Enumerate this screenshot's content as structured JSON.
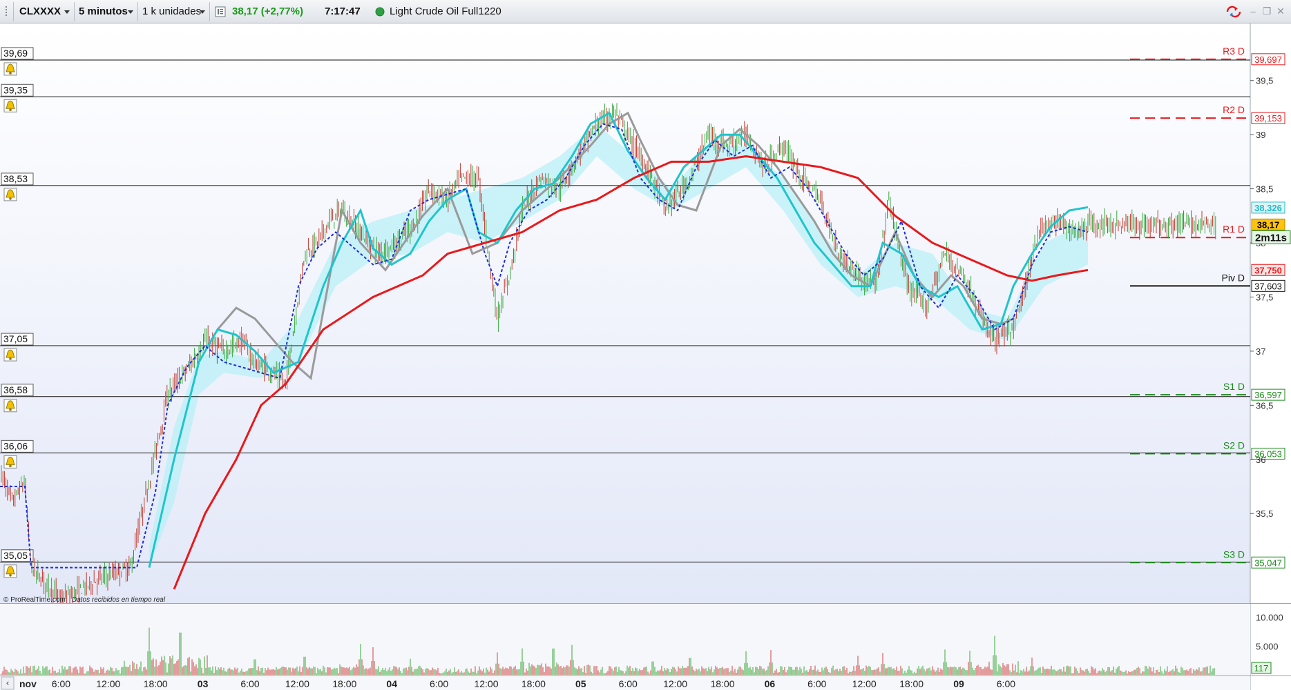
{
  "toolbar": {
    "symbol": "CLXXXX",
    "timeframe": "5 minutos",
    "units": "1 k unidades",
    "price": "38,17 (+2,77%)",
    "time": "7:17:47",
    "instrument": "Light Crude Oil Full1220",
    "colors": {
      "up": "#1a9a1a",
      "status": "#2ea043"
    }
  },
  "window_controls": {
    "sync_icon": "sync-arrows-icon",
    "minimize": "–",
    "restore": "❐",
    "close": "✕"
  },
  "alerts": [
    {
      "label": "39,69",
      "value": 39.69
    },
    {
      "label": "39,35",
      "value": 39.35
    },
    {
      "label": "38,53",
      "value": 38.53
    },
    {
      "label": "37,05",
      "value": 37.05
    },
    {
      "label": "36,58",
      "value": 36.58
    },
    {
      "label": "36,06",
      "value": 36.06
    },
    {
      "label": "35,05",
      "value": 35.05
    }
  ],
  "pivots": [
    {
      "name": "R3 D",
      "label": "39,697",
      "value": 39.697,
      "color": "#e8191b",
      "style": "dashed"
    },
    {
      "name": "R2 D",
      "label": "39,153",
      "value": 39.153,
      "color": "#e8191b",
      "style": "dashed"
    },
    {
      "name": "R1 D",
      "label": "",
      "value": 38.05,
      "color": "#e8191b",
      "style": "dashed"
    },
    {
      "name": "Piv D",
      "label": "37,603",
      "value": 37.603,
      "color": "#111111",
      "style": "solid"
    },
    {
      "name": "S1 D",
      "label": "36,597",
      "value": 36.597,
      "color": "#1a8a1a",
      "style": "dashed"
    },
    {
      "name": "S2 D",
      "label": "36,053",
      "value": 36.053,
      "color": "#1a8a1a",
      "style": "dashed"
    },
    {
      "name": "S3 D",
      "label": "35,047",
      "value": 35.047,
      "color": "#1a8a1a",
      "style": "dashed"
    }
  ],
  "price_axis": {
    "ticks": [
      {
        "label": "39,5",
        "value": 39.5
      },
      {
        "label": "39",
        "value": 39.0
      },
      {
        "label": "38,5",
        "value": 38.5
      },
      {
        "label": "38",
        "value": 38.0
      },
      {
        "label": "37,5",
        "value": 37.5
      },
      {
        "label": "37",
        "value": 37.0
      },
      {
        "label": "36,5",
        "value": 36.5
      },
      {
        "label": "36",
        "value": 36.0
      },
      {
        "label": "35,5",
        "value": 35.5
      }
    ],
    "markers": [
      {
        "label": "38,326",
        "value": 38.326,
        "bg": "#dff6f8",
        "fg": "#20b8c8",
        "border": "#20b8c8"
      },
      {
        "label": "38,17",
        "value": 38.17,
        "bg": "#ffc20e",
        "fg": "#000000",
        "border": "#b08a00"
      },
      {
        "label": "37,750",
        "value": 37.75,
        "bg": "#fde4e4",
        "fg": "#e8191b",
        "border": "#e8191b"
      }
    ],
    "countdown": "2m11s"
  },
  "volume_axis": {
    "ticks": [
      {
        "label": "10.000",
        "value": 10000
      },
      {
        "label": "5.000",
        "value": 5000
      }
    ],
    "current": "117"
  },
  "credits": {
    "brand": "© ProRealTime.com",
    "note": "Datos recibidos en tiempo real"
  },
  "time_axis": {
    "labels": [
      {
        "t": "nov",
        "x": 0.0,
        "bold": true
      },
      {
        "t": "6:00",
        "x": 0.076,
        "bold": false
      },
      {
        "t": "12:00",
        "x": 0.152,
        "bold": false
      },
      {
        "t": "18:00",
        "x": 0.228,
        "bold": false
      },
      {
        "t": "03",
        "x": 0.304,
        "bold": true
      },
      {
        "t": "6:00",
        "x": 0.38,
        "bold": false
      },
      {
        "t": "12:00",
        "x": 0.456,
        "bold": false
      },
      {
        "t": "18:00",
        "x": 0.532,
        "bold": false
      },
      {
        "t": "04",
        "x": 0.608,
        "bold": true
      },
      {
        "t": "6:00",
        "x": 0.684,
        "bold": false
      },
      {
        "t": "12:00",
        "x": 0.76,
        "bold": false
      },
      {
        "t": "18:00",
        "x": 0.836,
        "bold": false
      },
      {
        "t": "05",
        "x": 0.912,
        "bold": true
      },
      {
        "t": "6:00",
        "x": 0.988,
        "bold": false
      },
      {
        "t": "12:00",
        "x": 1.064,
        "bold": false
      },
      {
        "t": "18:00",
        "x": 1.14,
        "bold": false
      },
      {
        "t": "06",
        "x": 1.216,
        "bold": true
      },
      {
        "t": "6:00",
        "x": 1.292,
        "bold": false
      },
      {
        "t": "12:00",
        "x": 1.368,
        "bold": false
      },
      {
        "t": "18:00",
        "x": 1.444,
        "bold": false
      },
      {
        "t": "09",
        "x": 1.52,
        "bold": true
      },
      {
        "t": "6:00",
        "x": 1.596,
        "bold": false
      }
    ]
  },
  "chart_data": {
    "type": "line",
    "y_range": [
      34.8,
      39.9
    ],
    "price_path": [
      [
        0.0,
        35.9
      ],
      [
        0.02,
        35.6
      ],
      [
        0.04,
        35.8
      ],
      [
        0.05,
        35.0
      ],
      [
        0.1,
        34.7
      ],
      [
        0.16,
        34.9
      ],
      [
        0.21,
        35.0
      ],
      [
        0.24,
        35.8
      ],
      [
        0.27,
        36.6
      ],
      [
        0.31,
        36.9
      ],
      [
        0.33,
        37.1
      ],
      [
        0.36,
        37.0
      ],
      [
        0.39,
        37.1
      ],
      [
        0.41,
        36.9
      ],
      [
        0.44,
        36.8
      ],
      [
        0.46,
        36.7
      ],
      [
        0.49,
        37.9
      ],
      [
        0.51,
        38.0
      ],
      [
        0.53,
        38.2
      ],
      [
        0.55,
        38.3
      ],
      [
        0.58,
        38.1
      ],
      [
        0.61,
        37.9
      ],
      [
        0.64,
        38.0
      ],
      [
        0.67,
        38.2
      ],
      [
        0.69,
        38.5
      ],
      [
        0.72,
        38.4
      ],
      [
        0.74,
        38.6
      ],
      [
        0.77,
        38.6
      ],
      [
        0.8,
        37.3
      ],
      [
        0.82,
        37.7
      ],
      [
        0.84,
        38.3
      ],
      [
        0.87,
        38.6
      ],
      [
        0.9,
        38.5
      ],
      [
        0.93,
        38.8
      ],
      [
        0.96,
        39.1
      ],
      [
        0.99,
        39.2
      ],
      [
        1.02,
        38.9
      ],
      [
        1.05,
        38.6
      ],
      [
        1.07,
        38.3
      ],
      [
        1.11,
        38.6
      ],
      [
        1.14,
        39.0
      ],
      [
        1.17,
        38.9
      ],
      [
        1.2,
        39.0
      ],
      [
        1.23,
        38.7
      ],
      [
        1.26,
        38.9
      ],
      [
        1.29,
        38.6
      ],
      [
        1.32,
        38.4
      ],
      [
        1.35,
        37.9
      ],
      [
        1.38,
        37.7
      ],
      [
        1.41,
        37.6
      ],
      [
        1.43,
        38.4
      ],
      [
        1.46,
        37.6
      ],
      [
        1.49,
        37.4
      ],
      [
        1.52,
        37.9
      ],
      [
        1.55,
        37.7
      ],
      [
        1.58,
        37.3
      ],
      [
        1.6,
        37.1
      ],
      [
        1.63,
        37.2
      ],
      [
        1.65,
        37.6
      ],
      [
        1.67,
        38.1
      ],
      [
        1.7,
        38.2
      ],
      [
        1.73,
        38.1
      ],
      [
        1.75,
        38.17
      ]
    ],
    "sma_red": [
      [
        0.28,
        34.8
      ],
      [
        0.33,
        35.5
      ],
      [
        0.38,
        36.0
      ],
      [
        0.42,
        36.5
      ],
      [
        0.46,
        36.7
      ],
      [
        0.52,
        37.2
      ],
      [
        0.6,
        37.5
      ],
      [
        0.68,
        37.7
      ],
      [
        0.72,
        37.9
      ],
      [
        0.78,
        38.0
      ],
      [
        0.84,
        38.1
      ],
      [
        0.9,
        38.3
      ],
      [
        0.96,
        38.4
      ],
      [
        1.02,
        38.6
      ],
      [
        1.08,
        38.75
      ],
      [
        1.14,
        38.75
      ],
      [
        1.2,
        38.8
      ],
      [
        1.26,
        38.75
      ],
      [
        1.32,
        38.7
      ],
      [
        1.38,
        38.6
      ],
      [
        1.44,
        38.25
      ],
      [
        1.5,
        38.0
      ],
      [
        1.56,
        37.85
      ],
      [
        1.62,
        37.7
      ],
      [
        1.66,
        37.65
      ],
      [
        1.7,
        37.7
      ],
      [
        1.75,
        37.75
      ]
    ],
    "ma_cyan": [
      [
        0.24,
        35.0
      ],
      [
        0.28,
        36.0
      ],
      [
        0.32,
        36.9
      ],
      [
        0.35,
        37.2
      ],
      [
        0.38,
        37.15
      ],
      [
        0.41,
        37.0
      ],
      [
        0.44,
        36.8
      ],
      [
        0.48,
        36.9
      ],
      [
        0.52,
        37.6
      ],
      [
        0.55,
        38.0
      ],
      [
        0.58,
        38.3
      ],
      [
        0.6,
        37.95
      ],
      [
        0.63,
        37.8
      ],
      [
        0.66,
        37.9
      ],
      [
        0.69,
        38.2
      ],
      [
        0.72,
        38.4
      ],
      [
        0.75,
        38.5
      ],
      [
        0.77,
        38.1
      ],
      [
        0.8,
        38.0
      ],
      [
        0.83,
        38.3
      ],
      [
        0.86,
        38.5
      ],
      [
        0.89,
        38.55
      ],
      [
        0.92,
        38.8
      ],
      [
        0.95,
        39.1
      ],
      [
        0.98,
        39.2
      ],
      [
        1.01,
        38.85
      ],
      [
        1.04,
        38.6
      ],
      [
        1.07,
        38.4
      ],
      [
        1.1,
        38.7
      ],
      [
        1.13,
        38.85
      ],
      [
        1.16,
        39.0
      ],
      [
        1.19,
        39.0
      ],
      [
        1.22,
        38.8
      ],
      [
        1.25,
        38.6
      ],
      [
        1.28,
        38.3
      ],
      [
        1.31,
        38.0
      ],
      [
        1.34,
        37.8
      ],
      [
        1.37,
        37.6
      ],
      [
        1.4,
        37.6
      ],
      [
        1.42,
        38.0
      ],
      [
        1.45,
        37.9
      ],
      [
        1.48,
        37.6
      ],
      [
        1.51,
        37.5
      ],
      [
        1.54,
        37.6
      ],
      [
        1.56,
        37.4
      ],
      [
        1.58,
        37.2
      ],
      [
        1.61,
        37.25
      ],
      [
        1.63,
        37.6
      ],
      [
        1.66,
        37.9
      ],
      [
        1.69,
        38.15
      ],
      [
        1.72,
        38.3
      ],
      [
        1.75,
        38.33
      ]
    ],
    "ma_grey": [
      [
        0.35,
        37.2
      ],
      [
        0.38,
        37.4
      ],
      [
        0.41,
        37.3
      ],
      [
        0.44,
        37.1
      ],
      [
        0.47,
        36.9
      ],
      [
        0.5,
        36.75
      ],
      [
        0.55,
        38.3
      ],
      [
        0.58,
        38.0
      ],
      [
        0.62,
        37.75
      ],
      [
        0.68,
        38.25
      ],
      [
        0.72,
        38.5
      ],
      [
        0.74,
        38.2
      ],
      [
        0.76,
        37.9
      ],
      [
        0.8,
        38.0
      ],
      [
        0.84,
        38.3
      ],
      [
        0.9,
        38.6
      ],
      [
        0.95,
        38.9
      ],
      [
        0.98,
        39.1
      ],
      [
        1.01,
        39.2
      ],
      [
        1.03,
        38.95
      ],
      [
        1.06,
        38.6
      ],
      [
        1.09,
        38.35
      ],
      [
        1.12,
        38.3
      ],
      [
        1.16,
        38.9
      ],
      [
        1.19,
        39.05
      ],
      [
        1.22,
        38.9
      ],
      [
        1.25,
        38.7
      ],
      [
        1.28,
        38.45
      ],
      [
        1.31,
        38.2
      ],
      [
        1.34,
        37.9
      ],
      [
        1.37,
        37.7
      ],
      [
        1.4,
        37.6
      ],
      [
        1.44,
        38.1
      ],
      [
        1.47,
        37.7
      ],
      [
        1.5,
        37.5
      ],
      [
        1.53,
        37.7
      ],
      [
        1.55,
        37.6
      ],
      [
        1.58,
        37.3
      ],
      [
        1.61,
        37.25
      ],
      [
        1.63,
        37.3
      ]
    ],
    "ma_blue_dashed": [
      [
        0.0,
        35.75
      ],
      [
        0.04,
        35.75
      ],
      [
        0.05,
        35.0
      ],
      [
        0.22,
        35.0
      ],
      [
        0.25,
        35.7
      ],
      [
        0.27,
        36.5
      ],
      [
        0.3,
        36.85
      ],
      [
        0.33,
        37.05
      ],
      [
        0.36,
        36.9
      ],
      [
        0.39,
        36.85
      ],
      [
        0.42,
        36.8
      ],
      [
        0.45,
        36.75
      ],
      [
        0.48,
        37.6
      ],
      [
        0.51,
        37.95
      ],
      [
        0.54,
        38.1
      ],
      [
        0.57,
        37.95
      ],
      [
        0.6,
        37.8
      ],
      [
        0.63,
        37.85
      ],
      [
        0.66,
        38.3
      ],
      [
        0.69,
        38.4
      ],
      [
        0.72,
        38.45
      ],
      [
        0.75,
        38.5
      ],
      [
        0.78,
        37.9
      ],
      [
        0.8,
        37.6
      ],
      [
        0.82,
        38.0
      ],
      [
        0.85,
        38.3
      ],
      [
        0.88,
        38.4
      ],
      [
        0.91,
        38.6
      ],
      [
        0.94,
        38.9
      ],
      [
        0.97,
        39.1
      ],
      [
        1.0,
        39.05
      ],
      [
        1.03,
        38.6
      ],
      [
        1.06,
        38.4
      ],
      [
        1.09,
        38.3
      ],
      [
        1.12,
        38.7
      ],
      [
        1.15,
        38.95
      ],
      [
        1.18,
        38.8
      ],
      [
        1.21,
        38.9
      ],
      [
        1.24,
        38.6
      ],
      [
        1.27,
        38.7
      ],
      [
        1.3,
        38.5
      ],
      [
        1.33,
        38.2
      ],
      [
        1.36,
        37.9
      ],
      [
        1.39,
        37.7
      ],
      [
        1.42,
        37.85
      ],
      [
        1.45,
        38.2
      ],
      [
        1.48,
        37.6
      ],
      [
        1.51,
        37.4
      ],
      [
        1.54,
        37.7
      ],
      [
        1.57,
        37.5
      ],
      [
        1.6,
        37.2
      ],
      [
        1.63,
        37.3
      ],
      [
        1.66,
        37.8
      ],
      [
        1.69,
        38.1
      ],
      [
        1.72,
        38.15
      ],
      [
        1.75,
        38.1
      ]
    ],
    "cloud_top": [
      [
        0.24,
        35.2
      ],
      [
        0.28,
        36.3
      ],
      [
        0.32,
        36.95
      ],
      [
        0.36,
        37.0
      ],
      [
        0.42,
        36.9
      ],
      [
        0.48,
        37.3
      ],
      [
        0.54,
        38.0
      ],
      [
        0.6,
        38.2
      ],
      [
        0.66,
        38.3
      ],
      [
        0.72,
        38.4
      ],
      [
        0.78,
        38.5
      ],
      [
        0.84,
        38.6
      ],
      [
        0.9,
        38.8
      ],
      [
        0.96,
        39.1
      ],
      [
        1.02,
        38.8
      ],
      [
        1.08,
        38.5
      ],
      [
        1.14,
        38.9
      ],
      [
        1.2,
        38.9
      ],
      [
        1.26,
        38.6
      ],
      [
        1.32,
        38.1
      ],
      [
        1.38,
        37.7
      ],
      [
        1.44,
        38.0
      ],
      [
        1.5,
        37.9
      ],
      [
        1.56,
        37.4
      ],
      [
        1.62,
        37.3
      ],
      [
        1.68,
        38.0
      ],
      [
        1.75,
        38.2
      ]
    ],
    "cloud_bottom": [
      [
        0.24,
        35.0
      ],
      [
        0.28,
        35.6
      ],
      [
        0.32,
        36.6
      ],
      [
        0.36,
        36.8
      ],
      [
        0.42,
        36.75
      ],
      [
        0.48,
        36.9
      ],
      [
        0.54,
        37.6
      ],
      [
        0.6,
        37.85
      ],
      [
        0.66,
        37.9
      ],
      [
        0.72,
        38.1
      ],
      [
        0.78,
        38.0
      ],
      [
        0.84,
        38.2
      ],
      [
        0.9,
        38.4
      ],
      [
        0.96,
        38.8
      ],
      [
        1.02,
        38.5
      ],
      [
        1.08,
        38.3
      ],
      [
        1.14,
        38.5
      ],
      [
        1.2,
        38.7
      ],
      [
        1.26,
        38.3
      ],
      [
        1.32,
        37.8
      ],
      [
        1.38,
        37.5
      ],
      [
        1.44,
        37.6
      ],
      [
        1.5,
        37.5
      ],
      [
        1.56,
        37.2
      ],
      [
        1.62,
        37.1
      ],
      [
        1.68,
        37.6
      ],
      [
        1.75,
        37.8
      ]
    ],
    "volume_max": 12000,
    "volume_spikes": [
      [
        0.24,
        8200
      ],
      [
        0.29,
        9800
      ],
      [
        0.41,
        3600
      ],
      [
        0.49,
        4200
      ],
      [
        0.58,
        5400
      ],
      [
        0.6,
        4800
      ],
      [
        0.66,
        2800
      ],
      [
        0.8,
        3900
      ],
      [
        0.84,
        4600
      ],
      [
        0.89,
        6100
      ],
      [
        0.92,
        5200
      ],
      [
        1.05,
        3100
      ],
      [
        1.11,
        3900
      ],
      [
        1.2,
        4100
      ],
      [
        1.24,
        4300
      ],
      [
        1.38,
        3300
      ],
      [
        1.42,
        3800
      ],
      [
        1.52,
        4400
      ],
      [
        1.56,
        4200
      ],
      [
        1.6,
        6800
      ],
      [
        1.66,
        3000
      ],
      [
        1.72,
        1400
      ]
    ]
  }
}
